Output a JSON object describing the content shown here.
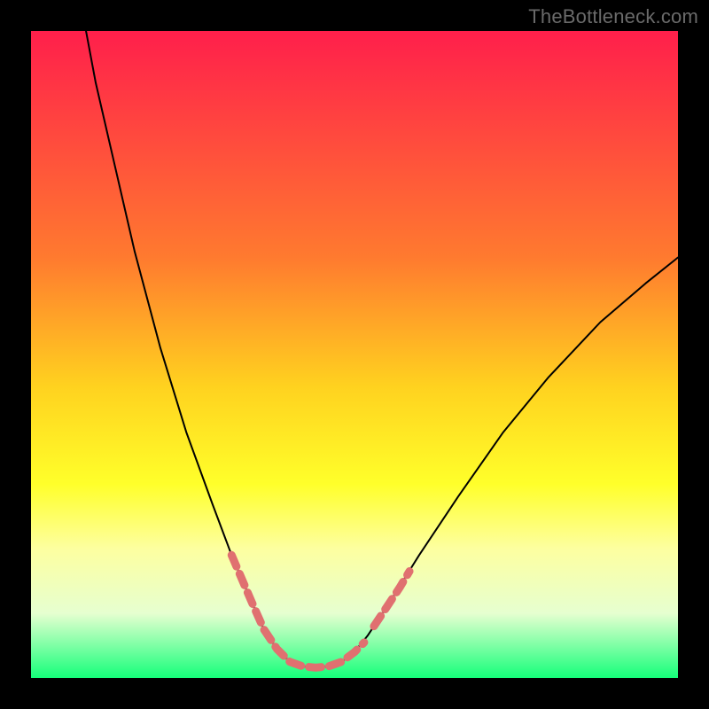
{
  "watermark": "TheBottleneck.com",
  "chart_data": {
    "type": "line",
    "title": "",
    "xlabel": "",
    "ylabel": "",
    "xlim": [
      0,
      100
    ],
    "ylim": [
      0,
      100
    ],
    "gradient_stops": [
      {
        "pos": 0.0,
        "color": "#ff1f4b"
      },
      {
        "pos": 0.35,
        "color": "#ff7a2f"
      },
      {
        "pos": 0.55,
        "color": "#ffd21f"
      },
      {
        "pos": 0.7,
        "color": "#ffff2a"
      },
      {
        "pos": 0.8,
        "color": "#fdffa0"
      },
      {
        "pos": 0.9,
        "color": "#e6ffd0"
      },
      {
        "pos": 1.0,
        "color": "#15ff7a"
      }
    ],
    "series": [
      {
        "name": "curve",
        "color": "#000000",
        "points": [
          {
            "x": 8.5,
            "y": 100.0
          },
          {
            "x": 10.0,
            "y": 92.0
          },
          {
            "x": 13.0,
            "y": 79.0
          },
          {
            "x": 16.0,
            "y": 66.0
          },
          {
            "x": 20.0,
            "y": 51.0
          },
          {
            "x": 24.0,
            "y": 38.0
          },
          {
            "x": 28.0,
            "y": 27.0
          },
          {
            "x": 31.0,
            "y": 19.0
          },
          {
            "x": 34.0,
            "y": 12.0
          },
          {
            "x": 36.0,
            "y": 7.5
          },
          {
            "x": 38.0,
            "y": 4.5
          },
          {
            "x": 40.0,
            "y": 2.5
          },
          {
            "x": 42.0,
            "y": 1.8
          },
          {
            "x": 44.0,
            "y": 1.6
          },
          {
            "x": 46.0,
            "y": 1.8
          },
          {
            "x": 48.0,
            "y": 2.5
          },
          {
            "x": 50.0,
            "y": 4.0
          },
          {
            "x": 52.0,
            "y": 6.5
          },
          {
            "x": 55.0,
            "y": 11.0
          },
          {
            "x": 60.0,
            "y": 19.0
          },
          {
            "x": 66.0,
            "y": 28.0
          },
          {
            "x": 73.0,
            "y": 38.0
          },
          {
            "x": 80.0,
            "y": 46.5
          },
          {
            "x": 88.0,
            "y": 55.0
          },
          {
            "x": 95.0,
            "y": 61.0
          },
          {
            "x": 100.0,
            "y": 65.0
          }
        ]
      },
      {
        "name": "highlight-left",
        "color": "#e07070",
        "width": 9,
        "dash": "14 9",
        "points": [
          {
            "x": 31.0,
            "y": 19.0
          },
          {
            "x": 34.0,
            "y": 12.0
          },
          {
            "x": 36.0,
            "y": 7.5
          },
          {
            "x": 38.0,
            "y": 4.5
          },
          {
            "x": 40.0,
            "y": 2.5
          },
          {
            "x": 42.0,
            "y": 1.8
          },
          {
            "x": 44.0,
            "y": 1.6
          },
          {
            "x": 46.0,
            "y": 1.8
          },
          {
            "x": 48.0,
            "y": 2.5
          },
          {
            "x": 50.0,
            "y": 4.0
          },
          {
            "x": 51.5,
            "y": 5.5
          }
        ]
      },
      {
        "name": "highlight-right",
        "color": "#e07070",
        "width": 9,
        "dash": "14 9",
        "points": [
          {
            "x": 53.0,
            "y": 8.0
          },
          {
            "x": 55.0,
            "y": 11.0
          },
          {
            "x": 57.0,
            "y": 14.0
          },
          {
            "x": 58.5,
            "y": 16.5
          }
        ]
      }
    ]
  }
}
